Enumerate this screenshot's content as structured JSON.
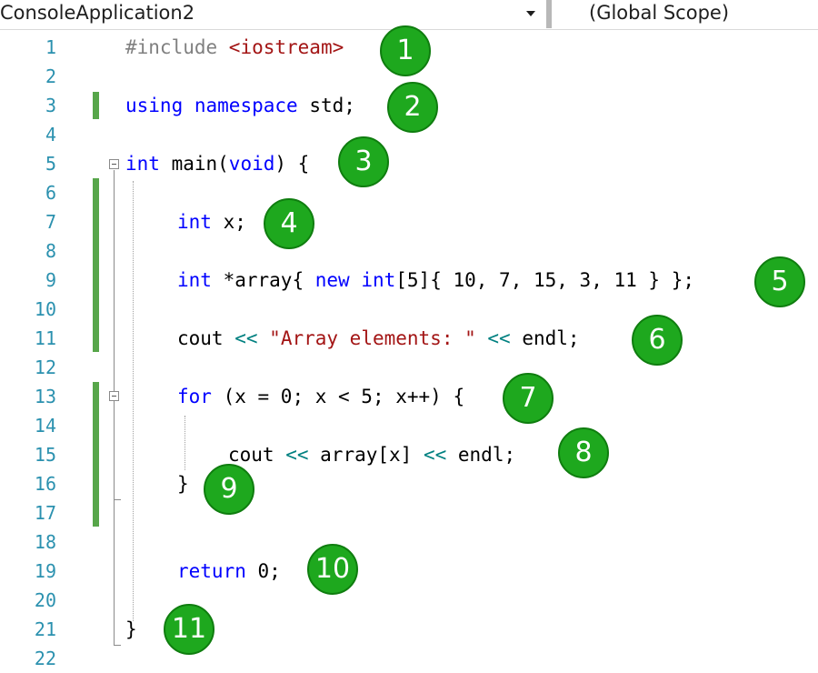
{
  "navbar": {
    "project": "ConsoleApplication2",
    "scope": "(Global Scope)"
  },
  "line_numbers": [
    "1",
    "2",
    "3",
    "4",
    "5",
    "6",
    "7",
    "8",
    "9",
    "10",
    "11",
    "12",
    "13",
    "14",
    "15",
    "16",
    "17",
    "18",
    "19",
    "20",
    "21",
    "22"
  ],
  "code": {
    "l1": {
      "a": "#include ",
      "b": "<iostream>"
    },
    "l3": {
      "a": "using",
      "b": " ",
      "c": "namespace",
      "d": " std;"
    },
    "l5": {
      "a": "int",
      "b": " main(",
      "c": "void",
      "d": ") {"
    },
    "l7": {
      "a": "int",
      "b": " x;"
    },
    "l9": {
      "a": "int",
      "b": " *array{ ",
      "c": "new",
      "d": " ",
      "e": "int",
      "f": "[5]{ 10, 7, 15, 3, 11 } };"
    },
    "l11": {
      "a": "cout ",
      "b": "<<",
      "c": " ",
      "d": "\"Array elements: \"",
      "e": " ",
      "f": "<<",
      "g": " endl;"
    },
    "l13": {
      "a": "for",
      "b": " (x = 0; x < 5; x++) {"
    },
    "l15": {
      "a": "cout ",
      "b": "<<",
      "c": " array[x] ",
      "d": "<<",
      "e": " endl;"
    },
    "l16": {
      "a": "}"
    },
    "l19": {
      "a": "return",
      "b": " 0;"
    },
    "l21": {
      "a": "}"
    }
  },
  "badges": [
    "1",
    "2",
    "3",
    "4",
    "5",
    "6",
    "7",
    "8",
    "9",
    "10",
    "11"
  ],
  "colors": {
    "keyword": "#0000ff",
    "string": "#a31515",
    "preprocessor": "#808080",
    "line_number": "#2b91af",
    "badge": "#1ea81e",
    "change_bar": "#57a64a"
  }
}
